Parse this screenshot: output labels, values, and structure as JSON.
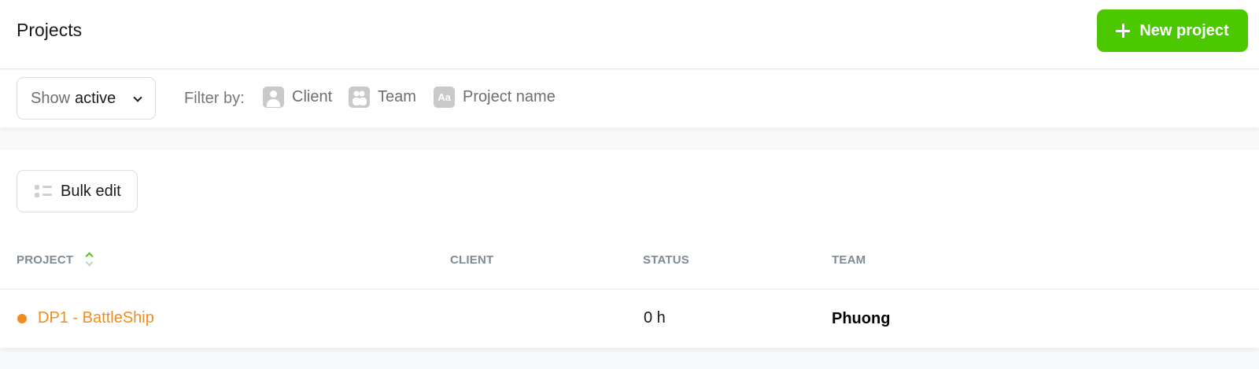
{
  "header": {
    "title": "Projects",
    "new_project_label": "New project",
    "new_project_icon": "plus-icon",
    "accent_color": "#4bc800"
  },
  "filters": {
    "show_prefix": "Show",
    "show_value": "active",
    "filter_by_label": "Filter by:",
    "items": [
      {
        "label": "Client",
        "icon": "person-icon"
      },
      {
        "label": "Team",
        "icon": "team-icon"
      },
      {
        "label": "Project name",
        "icon": "text-aa-icon",
        "icon_text": "Aa"
      }
    ]
  },
  "toolbar": {
    "bulk_edit_label": "Bulk edit",
    "bulk_edit_icon": "list-icon"
  },
  "table": {
    "columns": [
      "PROJECT",
      "CLIENT",
      "STATUS",
      "TEAM"
    ],
    "sorted_column": "PROJECT",
    "rows": [
      {
        "project": "DP1 - BattleShip",
        "project_color": "#f08c1e",
        "client": "",
        "status": "0 h",
        "team": "Phuong"
      }
    ]
  }
}
